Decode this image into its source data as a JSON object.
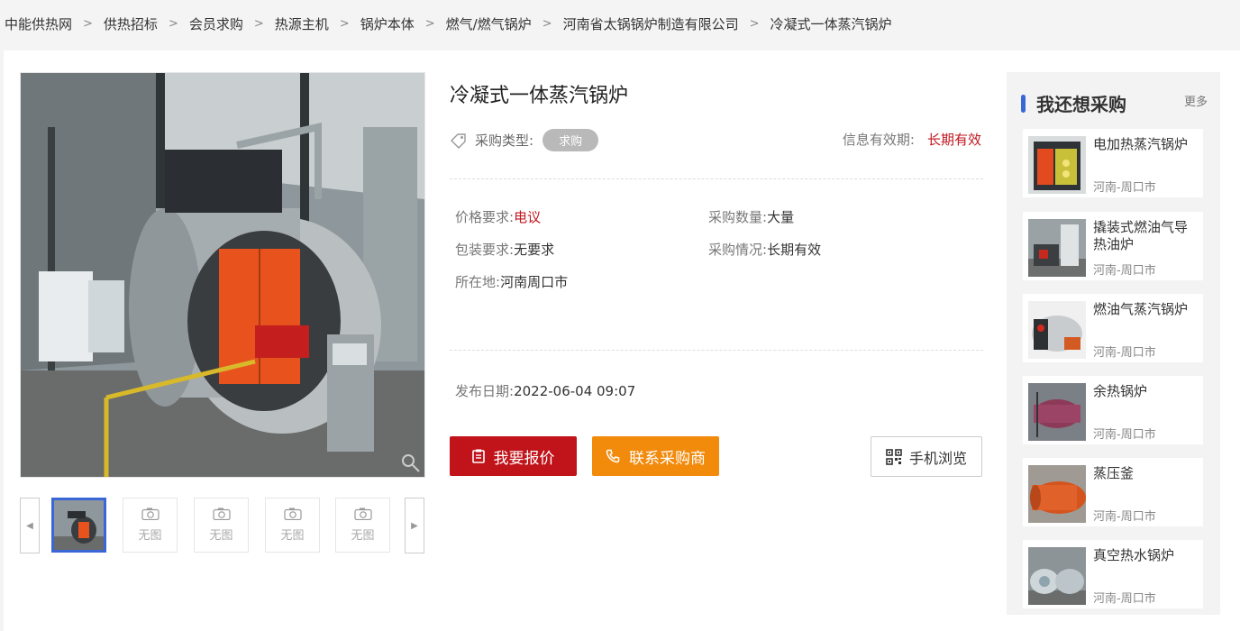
{
  "breadcrumb": [
    "中能供热网",
    "供热招标",
    "会员求购",
    "热源主机",
    "锅炉本体",
    "燃气/燃气锅炉",
    "河南省太锅锅炉制造有限公司",
    "冷凝式一体蒸汽锅炉"
  ],
  "product": {
    "title": "冷凝式一体蒸汽锅炉",
    "type_label": "采购类型:",
    "type_tag": "求购",
    "validity_label": "信息有效期:",
    "validity_value": "长期有效",
    "price_label": "价格要求:",
    "price_value": "电议",
    "quantity_label": "采购数量:",
    "quantity_value": "大量",
    "package_label": "包装要求:",
    "package_value": "无要求",
    "status_label": "采购情况:",
    "status_value": "长期有效",
    "location_label": "所在地:",
    "location_value": "河南周口市",
    "date_label": "发布日期:",
    "date_value": "2022-06-04 09:07"
  },
  "gallery": {
    "no_image_label": "无图"
  },
  "actions": {
    "quote": "我要报价",
    "contact": "联系采购商",
    "mobile": "手机浏览"
  },
  "sidebar": {
    "title": "我还想采购",
    "more": "更多",
    "items": [
      {
        "name": "电加热蒸汽锅炉",
        "location": "河南-周口市"
      },
      {
        "name": "撬装式燃油气导热油炉",
        "location": "河南-周口市"
      },
      {
        "name": "燃油气蒸汽锅炉",
        "location": "河南-周口市"
      },
      {
        "name": "余热锅炉",
        "location": "河南-周口市"
      },
      {
        "name": "蒸压釜",
        "location": "河南-周口市"
      },
      {
        "name": "真空热水锅炉",
        "location": "河南-周口市"
      }
    ]
  },
  "colors": {
    "accent_red": "#c0131a",
    "accent_orange": "#f28a0c",
    "accent_blue": "#3b66d6"
  }
}
